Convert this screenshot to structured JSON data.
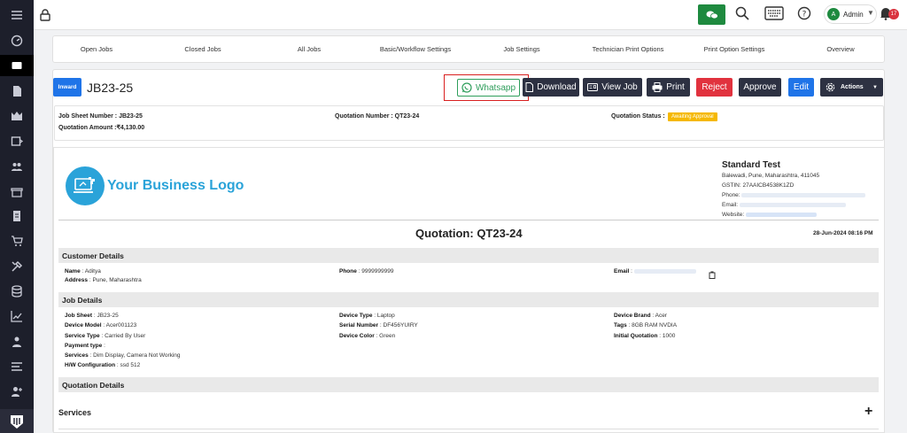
{
  "topbar": {
    "user_name": "Admin",
    "user_initial": "A",
    "notification_count": "17",
    "colors": {
      "chat_button": "#1e8a3f",
      "badge": "#d9343f"
    }
  },
  "tabs": [
    {
      "label": "Open Jobs"
    },
    {
      "label": "Closed Jobs"
    },
    {
      "label": "All Jobs"
    },
    {
      "label": "Basic/Workflow Settings"
    },
    {
      "label": "Job Settings"
    },
    {
      "label": "Technician Print Options"
    },
    {
      "label": "Print Option Settings"
    },
    {
      "label": "Overview"
    }
  ],
  "header": {
    "badge": "Inward",
    "job_id": "JB23-25"
  },
  "actions": {
    "whatsapp": "Whatsapp",
    "download": "Download",
    "view_job": "View Job",
    "print": "Print",
    "reject": "Reject",
    "approve": "Approve",
    "edit": "Edit",
    "actions": "Actions"
  },
  "summary": {
    "job_sheet_label": "Job Sheet Number :",
    "job_sheet_value": "JB23-25",
    "quote_amount_label": "Quotation Amount :",
    "quote_amount_value": "₹4,130.00",
    "quote_number_label": "Quotation Number :",
    "quote_number_value": "QT23-24",
    "quote_status_label": "Quotation Status :",
    "quote_status_value": "Awaiting Approval"
  },
  "document": {
    "logo_text": "Your Business Logo",
    "business_name": "Standard Test",
    "address": "Balewadi, Pune, Maharashtra, 411045",
    "gstin": "GSTIN: 27AAICB4538K1ZD",
    "phone_label": "Phone:",
    "email_label": "Email:",
    "website_label": "Website:",
    "title": "Quotation: QT23-24",
    "date": "28-Jun-2024 08:16 PM"
  },
  "customer": {
    "heading": "Customer Details",
    "name_label": "Name",
    "name": "Aditya",
    "address_label": "Address",
    "address": "Pune, Maharashtra",
    "phone_label": "Phone",
    "phone": "9999999999",
    "email_label": "Email"
  },
  "job_details": {
    "heading": "Job Details",
    "job_sheet_label": "Job Sheet",
    "job_sheet": "JB23-25",
    "device_model_label": "Device Model",
    "device_model": "Acer001123",
    "service_type_label": "Service Type",
    "service_type": "Carried By User",
    "payment_type_label": "Payment type",
    "services_label": "Services",
    "services": "Dim Display, Camera Not Working",
    "hw_config_label": "H/W Configuration",
    "hw_config": "ssd 512",
    "device_type_label": "Device Type",
    "device_type": "Laptop",
    "serial_label": "Serial Number",
    "serial": "DF456YUIRY",
    "device_color_label": "Device Color",
    "device_color": "Green",
    "brand_label": "Device Brand",
    "brand": "Acer",
    "tags_label": "Tags",
    "tags": "8GB RAM NVDIA",
    "initial_quote_label": "Initial Quotation",
    "initial_quote": "1000"
  },
  "quotation_details": {
    "heading": "Quotation Details",
    "services_heading": "Services"
  },
  "icons": {
    "sidebar": [
      "hamburger-icon",
      "dashboard-icon",
      "jobs-icon",
      "document-icon",
      "inventory-icon",
      "box-icon",
      "users-icon",
      "store-icon",
      "invoice-icon",
      "cart-icon",
      "tools-icon",
      "database-icon",
      "chart-icon",
      "person-icon",
      "list-icon",
      "user-plus-icon"
    ]
  }
}
